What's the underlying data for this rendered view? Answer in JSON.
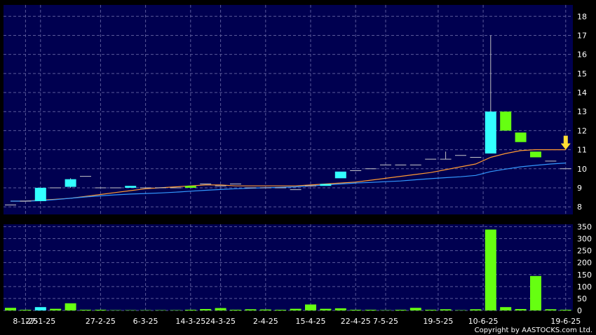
{
  "copyright": "Copyright by AASTOCKS.com Ltd.",
  "colors": {
    "panel_bg": "#000050",
    "grid": "#5a5a9a",
    "up": "#33ffff",
    "down": "#66ff11",
    "ma_short": "#ff9933",
    "ma_long": "#3399ff",
    "marker": "#ffdd33",
    "text": "#ffffff"
  },
  "chart_data": [
    {
      "type": "candlestick",
      "ylim": [
        7.6,
        18.6
      ],
      "y_ticks": [
        8,
        9,
        10,
        11,
        12,
        13,
        14,
        15,
        16,
        17,
        18
      ],
      "grid": true,
      "candles": [
        {
          "o": 8.1,
          "h": 8.1,
          "l": 8.1,
          "c": 8.1
        },
        {
          "o": 8.3,
          "h": 8.3,
          "l": 8.3,
          "c": 8.3
        },
        {
          "o": 8.3,
          "h": 9.0,
          "l": 8.3,
          "c": 9.0
        },
        {
          "o": 9.0,
          "h": 9.0,
          "l": 9.0,
          "c": 9.0
        },
        {
          "o": 9.05,
          "h": 9.5,
          "l": 9.0,
          "c": 9.45
        },
        {
          "o": 9.6,
          "h": 9.6,
          "l": 9.6,
          "c": 9.6
        },
        {
          "o": 9.0,
          "h": 9.0,
          "l": 9.0,
          "c": 9.0
        },
        {
          "o": 9.0,
          "h": 9.0,
          "l": 9.0,
          "c": 9.0
        },
        {
          "o": 9.0,
          "h": 9.1,
          "l": 9.0,
          "c": 9.1
        },
        {
          "o": 9.0,
          "h": 9.0,
          "l": 9.0,
          "c": 9.0
        },
        {
          "o": 9.0,
          "h": 9.0,
          "l": 9.0,
          "c": 9.0
        },
        {
          "o": 9.0,
          "h": 9.0,
          "l": 9.0,
          "c": 9.0
        },
        {
          "o": 9.1,
          "h": 9.1,
          "l": 9.0,
          "c": 9.0
        },
        {
          "o": 9.2,
          "h": 9.2,
          "l": 9.2,
          "c": 9.2
        },
        {
          "o": 9.1,
          "h": 9.1,
          "l": 9.1,
          "c": 9.1
        },
        {
          "o": 9.2,
          "h": 9.2,
          "l": 9.2,
          "c": 9.2
        },
        {
          "o": 9.0,
          "h": 9.0,
          "l": 9.0,
          "c": 9.0
        },
        {
          "o": 9.0,
          "h": 9.0,
          "l": 9.0,
          "c": 9.0
        },
        {
          "o": 9.0,
          "h": 9.0,
          "l": 9.0,
          "c": 9.0
        },
        {
          "o": 8.9,
          "h": 8.9,
          "l": 8.9,
          "c": 8.9
        },
        {
          "o": 9.1,
          "h": 9.1,
          "l": 9.1,
          "c": 9.1
        },
        {
          "o": 9.1,
          "h": 9.2,
          "l": 9.1,
          "c": 9.2
        },
        {
          "o": 9.5,
          "h": 9.85,
          "l": 9.5,
          "c": 9.85
        },
        {
          "o": 9.9,
          "h": 9.9,
          "l": 9.9,
          "c": 9.9
        },
        {
          "o": 10.0,
          "h": 10.0,
          "l": 10.0,
          "c": 10.0
        },
        {
          "o": 10.2,
          "h": 10.2,
          "l": 10.2,
          "c": 10.2
        },
        {
          "o": 10.2,
          "h": 10.2,
          "l": 10.2,
          "c": 10.2
        },
        {
          "o": 10.2,
          "h": 10.2,
          "l": 10.2,
          "c": 10.2
        },
        {
          "o": 10.5,
          "h": 10.5,
          "l": 10.5,
          "c": 10.5
        },
        {
          "o": 10.5,
          "h": 10.9,
          "l": 10.5,
          "c": 10.5
        },
        {
          "o": 10.7,
          "h": 10.7,
          "l": 10.7,
          "c": 10.7
        },
        {
          "o": 10.6,
          "h": 10.6,
          "l": 10.6,
          "c": 10.6
        },
        {
          "o": 10.8,
          "h": 17.0,
          "l": 10.8,
          "c": 13.0
        },
        {
          "o": 13.0,
          "h": 13.0,
          "l": 12.0,
          "c": 12.0
        },
        {
          "o": 11.9,
          "h": 11.9,
          "l": 11.4,
          "c": 11.4
        },
        {
          "o": 10.9,
          "h": 10.9,
          "l": 10.6,
          "c": 10.6
        },
        {
          "o": 10.4,
          "h": 10.4,
          "l": 10.4,
          "c": 10.4
        },
        {
          "o": 10.0,
          "h": 10.0,
          "l": 10.0,
          "c": 10.0
        }
      ],
      "ma_short": [
        8.3,
        8.3,
        8.35,
        8.4,
        8.45,
        8.55,
        8.65,
        8.75,
        8.85,
        8.95,
        9.0,
        9.05,
        9.1,
        9.15,
        9.15,
        9.1,
        9.1,
        9.1,
        9.1,
        9.1,
        9.15,
        9.2,
        9.25,
        9.3,
        9.4,
        9.5,
        9.6,
        9.7,
        9.8,
        9.95,
        10.1,
        10.25,
        10.6,
        10.8,
        10.95,
        11.0,
        11.0,
        11.0
      ],
      "ma_long": [
        8.3,
        8.3,
        8.32,
        8.38,
        8.45,
        8.52,
        8.58,
        8.63,
        8.67,
        8.7,
        8.73,
        8.77,
        8.82,
        8.87,
        8.91,
        8.95,
        8.98,
        9.0,
        9.02,
        9.05,
        9.1,
        9.15,
        9.2,
        9.25,
        9.28,
        9.32,
        9.36,
        9.42,
        9.48,
        9.53,
        9.58,
        9.65,
        9.85,
        9.98,
        10.1,
        10.18,
        10.25,
        10.3
      ],
      "marker": {
        "index": 37,
        "value": 11.0
      }
    },
    {
      "type": "bar",
      "ylim": [
        0,
        360
      ],
      "y_ticks": [
        0,
        50,
        100,
        150,
        200,
        250,
        300,
        350
      ],
      "grid": true,
      "values": [
        11,
        2,
        14,
        7,
        30,
        1,
        3,
        0,
        0,
        0,
        0,
        0,
        3,
        6,
        10,
        3,
        5,
        4,
        2,
        7,
        25,
        7,
        9,
        2,
        2,
        0,
        2,
        11,
        3,
        5,
        0,
        5,
        338,
        14,
        6,
        144,
        5,
        3
      ],
      "directions": [
        "d",
        "d",
        "u",
        "d",
        "d",
        "d",
        "d",
        "d",
        "d",
        "d",
        "d",
        "d",
        "d",
        "d",
        "d",
        "d",
        "d",
        "d",
        "d",
        "d",
        "d",
        "d",
        "d",
        "d",
        "d",
        "d",
        "d",
        "d",
        "d",
        "d",
        "d",
        "d",
        "d",
        "d",
        "d",
        "d",
        "d",
        "d"
      ]
    }
  ],
  "x_labels": [
    {
      "index": 1.0,
      "text": "8-1-25"
    },
    {
      "index": 2.0,
      "text": "27-1-25"
    },
    {
      "index": 6.0,
      "text": "27-2-25"
    },
    {
      "index": 9.0,
      "text": "6-3-25"
    },
    {
      "index": 12.0,
      "text": "14-3-25"
    },
    {
      "index": 14.0,
      "text": "24-3-25"
    },
    {
      "index": 17.0,
      "text": "2-4-25"
    },
    {
      "index": 20.0,
      "text": "15-4-25"
    },
    {
      "index": 23.0,
      "text": "22-4-25"
    },
    {
      "index": 25.0,
      "text": "7-5-25"
    },
    {
      "index": 28.5,
      "text": "19-5-25"
    },
    {
      "index": 31.5,
      "text": "10-6-25"
    },
    {
      "index": 37.0,
      "text": "19-6-25"
    }
  ]
}
